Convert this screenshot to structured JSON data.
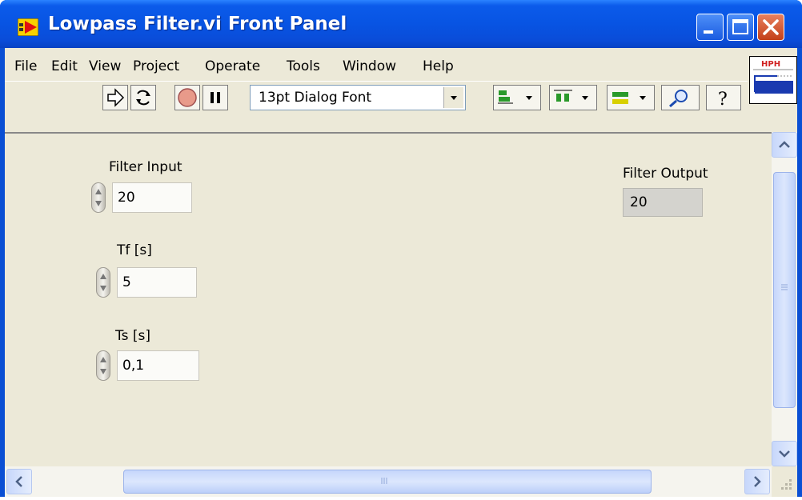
{
  "window": {
    "title": "Lowpass Filter.vi Front Panel"
  },
  "menubar": {
    "items": [
      {
        "label": "File"
      },
      {
        "label": "Edit"
      },
      {
        "label": "View"
      },
      {
        "label": "Project"
      },
      {
        "label": "Operate"
      },
      {
        "label": "Tools"
      },
      {
        "label": "Window"
      },
      {
        "label": "Help"
      }
    ]
  },
  "toolbar": {
    "font_select": "13pt Dialog Font"
  },
  "vi_icon": {
    "label": "HPH"
  },
  "controls": {
    "filter_input": {
      "label": "Filter Input",
      "value": "20"
    },
    "tf": {
      "label": "Tf [s]",
      "value": "5"
    },
    "ts": {
      "label": "Ts [s]",
      "value": "0,1"
    }
  },
  "indicators": {
    "filter_output": {
      "label": "Filter Output",
      "value": "20"
    }
  },
  "colors": {
    "titlebar": "#0854e3",
    "panel": "#ece9d8",
    "close_button": "#c3401a"
  }
}
